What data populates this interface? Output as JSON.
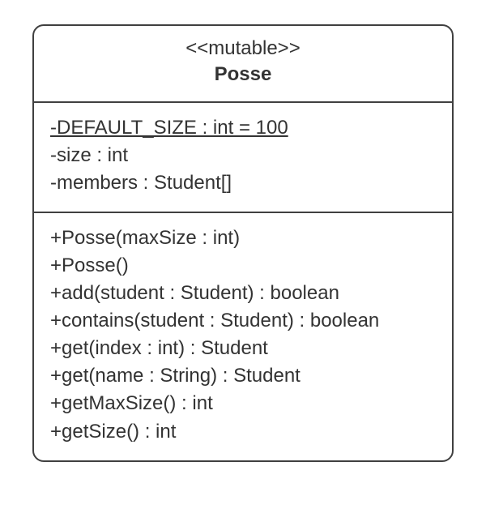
{
  "class": {
    "stereotype": "<<mutable>>",
    "name": "Posse",
    "attributes": [
      {
        "text": "-DEFAULT_SIZE : int = 100",
        "static": true
      },
      {
        "text": "-size : int",
        "static": false
      },
      {
        "text": "-members : Student[]",
        "static": false
      }
    ],
    "methods": [
      {
        "text": "+Posse(maxSize : int)"
      },
      {
        "text": "+Posse()"
      },
      {
        "text": "+add(student : Student) : boolean"
      },
      {
        "text": "+contains(student : Student) : boolean"
      },
      {
        "text": "+get(index : int) : Student"
      },
      {
        "text": "+get(name : String) : Student"
      },
      {
        "text": "+getMaxSize() : int"
      },
      {
        "text": "+getSize() : int"
      }
    ]
  }
}
